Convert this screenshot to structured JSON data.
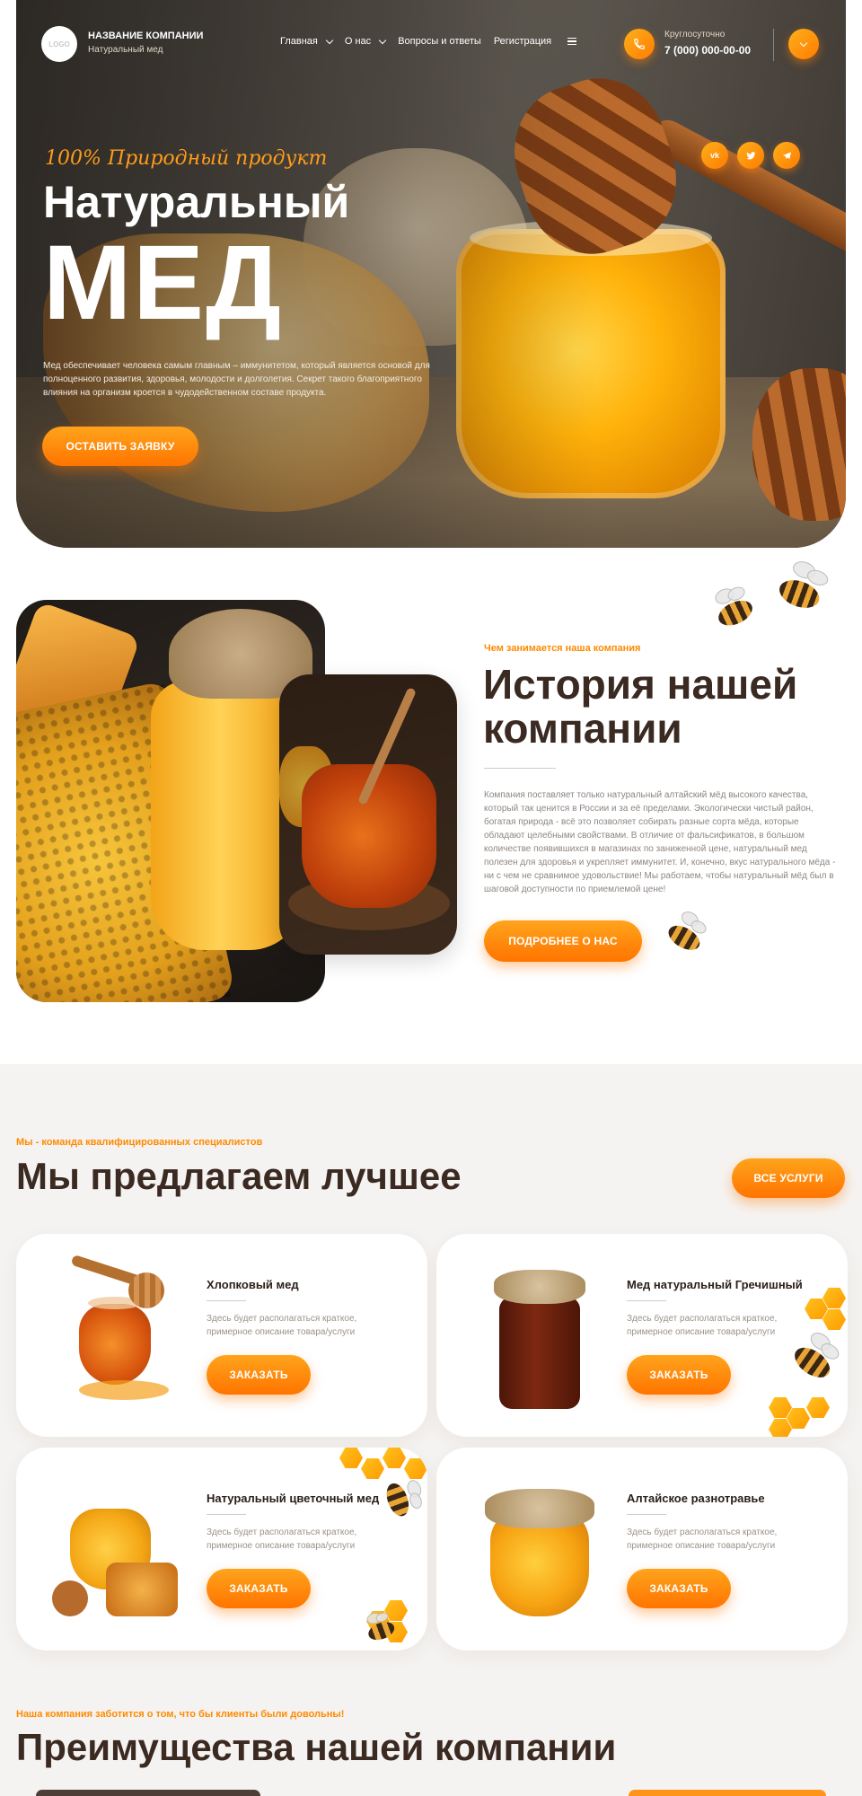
{
  "header": {
    "logo_text": "LOGO",
    "company_name": "НАЗВАНИЕ КОМПАНИИ",
    "company_sub": "Натуральный мед",
    "nav": [
      {
        "label": "Главная",
        "dropdown": true
      },
      {
        "label": "О нас",
        "dropdown": true
      },
      {
        "label": "Вопросы и ответы",
        "dropdown": false
      },
      {
        "label": "Регистрация",
        "dropdown": false
      }
    ],
    "phone_caption": "Круглосуточно",
    "phone_number": "7 (000) 000-00-00"
  },
  "socials": [
    "vk",
    "tw",
    "tg"
  ],
  "hero": {
    "tag": "100% Природный продукт",
    "title_line1": "Натуральный",
    "title_line2": "МЕД",
    "text": "Мед обеспечивает человека самым главным – иммунитетом, который является основой для полноценного развития, здоровья, молодости и долголетия. Секрет такого благоприятного влияния на организм кроется в чудодейственном составе продукта.",
    "button": "ОСТАВИТЬ ЗАЯВКУ"
  },
  "about": {
    "tag": "Чем занимается наша компания",
    "title": "История нашей компании",
    "text": "Компания поставляет только натуральный алтайский мёд высокого качества, который так ценится в России и за её пределами. Экологически чистый район, богатая природа - всё это позволяет собирать разные сорта мёда, которые обладают целебными свойствами. В отличие от фальсификатов, в большом количестве появившихся в магазинах по заниженной цене, натуральный мед полезен для здоровья и укрепляет иммунитет. И, конечно, вкус натурального мёда - ни с чем не сравнимое удовольствие! Мы работаем, чтобы натуральный мёд был в шаговой доступности по приемлемой цене!",
    "button": "ПОДРОБНЕЕ О НАС"
  },
  "services": {
    "tag": "Мы - команда квалифицированных специалистов",
    "title": "Мы предлагаем лучшее",
    "all_button": "ВСЕ УСЛУГИ",
    "items": [
      {
        "name": "Хлопковый мед",
        "desc": "Здесь будет располагаться краткое, примерное описание товара/услуги",
        "button": "ЗАКАЗАТЬ"
      },
      {
        "name": "Мед натуральный Гречишный",
        "desc": "Здесь будет располагаться краткое, примерное описание товара/услуги",
        "button": "ЗАКАЗАТЬ"
      },
      {
        "name": "Натуральный цветочный мед",
        "desc": "Здесь будет располагаться краткое, примерное описание товара/услуги",
        "button": "ЗАКАЗАТЬ"
      },
      {
        "name": "Алтайское разнотравье",
        "desc": "Здесь будет располагаться краткое, примерное описание товара/услуги",
        "button": "ЗАКАЗАТЬ"
      }
    ]
  },
  "advantages": {
    "tag": "Наша компания заботится о том, что бы клиенты были довольны!",
    "title": "Преимущества нашей компании"
  },
  "colors": {
    "accent": "#ff8a00",
    "accent_light": "#ffa41c",
    "heading": "#3b2a22",
    "section_bg": "#f5f3f1"
  }
}
